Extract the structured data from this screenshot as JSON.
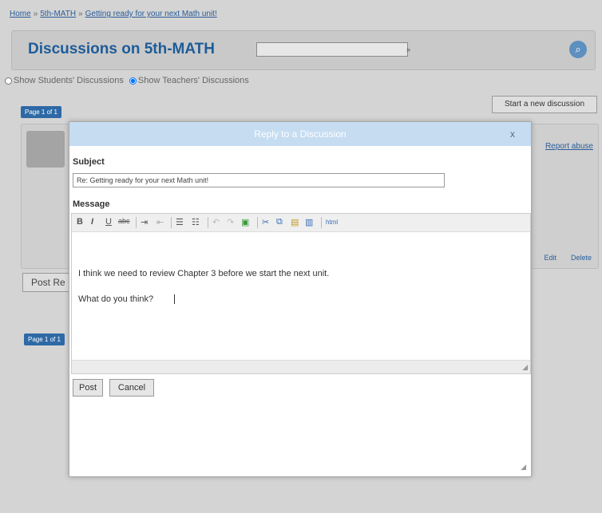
{
  "breadcrumb": {
    "home": "Home",
    "section": "5th-MATH",
    "current": "Getting ready for your next Math unit!",
    "separator": "»"
  },
  "header": {
    "title": "Discussions on 5th-MATH",
    "search_value": "",
    "go_label": "»",
    "search_icon": "search-icon"
  },
  "filters": {
    "students": "Show Students' Discussions",
    "teachers": "Show Teachers' Discussions"
  },
  "pagination": {
    "top_label": "Page 1 of 1",
    "bottom_label": "Page 1 of 1"
  },
  "actions": {
    "start_discussion": "Start a new discussion"
  },
  "post": {
    "report_abuse": "Report abuse",
    "edit": "Edit",
    "delete": "Delete",
    "post_reply_label": "Post Re"
  },
  "modal": {
    "title": "Reply to a Discussion",
    "close": "x",
    "subject_label": "Subject",
    "subject_value": "Re: Getting ready for your next Math unit!",
    "message_label": "Message",
    "message_lines": [
      "I think we need to review Chapter 3 before we start the next unit.",
      "What do you think?"
    ],
    "post_button": "Post",
    "cancel_button": "Cancel"
  },
  "toolbar": {
    "bold": "B",
    "italic": "I",
    "underline": "U",
    "strike": "abc",
    "indent": "⇥",
    "outdent": "⇤",
    "ordered_list": "☰",
    "bullet_list": "☷",
    "undo": "↶",
    "redo": "↷",
    "image": "▣",
    "cut": "✂",
    "copy": "⧉",
    "paste": "▤",
    "paste_word": "▥",
    "html": "html"
  },
  "colors": {
    "accent_blue": "#1e5c99",
    "link_blue": "#2a5d99",
    "titlebar": "#c5dcf1",
    "tab_blue": "#2e69a6"
  }
}
